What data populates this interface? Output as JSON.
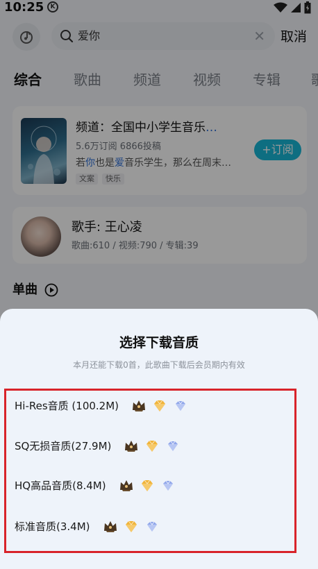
{
  "status_bar": {
    "time": "10:25",
    "k_badge": "K"
  },
  "search": {
    "query": "爱你",
    "cancel_label": "取消"
  },
  "tabs": [
    {
      "label": "综合",
      "active": true
    },
    {
      "label": "歌曲",
      "active": false
    },
    {
      "label": "频道",
      "active": false
    },
    {
      "label": "视频",
      "active": false
    },
    {
      "label": "专辑",
      "active": false
    },
    {
      "label": "歌",
      "active": false
    }
  ],
  "channel_card": {
    "title": "频道：全国中小学生音乐",
    "title_ellipsis": "…",
    "stats": "5.6万订阅 6866投稿",
    "desc_parts": [
      "若",
      "你",
      "也是",
      "爱",
      "音乐学生，那么在周末…"
    ],
    "tags": [
      "文案",
      "快乐"
    ],
    "subscribe_label": "+订阅"
  },
  "artist_card": {
    "name": "歌手: 王心凌",
    "stats": "歌曲:610 / 视频:790 / 专辑:39"
  },
  "section": {
    "title": "单曲"
  },
  "sheet": {
    "title": "选择下载音质",
    "subtitle": "本月还能下载0首，此歌曲下载后会员期内有效",
    "options": [
      {
        "label": "Hi-Res音质 (100.2M)"
      },
      {
        "label": "SQ无损音质(27.9M)"
      },
      {
        "label": "HQ高品音质(8.4M)"
      },
      {
        "label": "标准音质(3.4M)"
      }
    ]
  },
  "colors": {
    "accent": "#18b8d8",
    "highlight": "#2d6fd8",
    "outline": "#d8232a",
    "crown": "#4a3520",
    "gold": "#f0b43a",
    "diamond": "#8fa6ea"
  }
}
